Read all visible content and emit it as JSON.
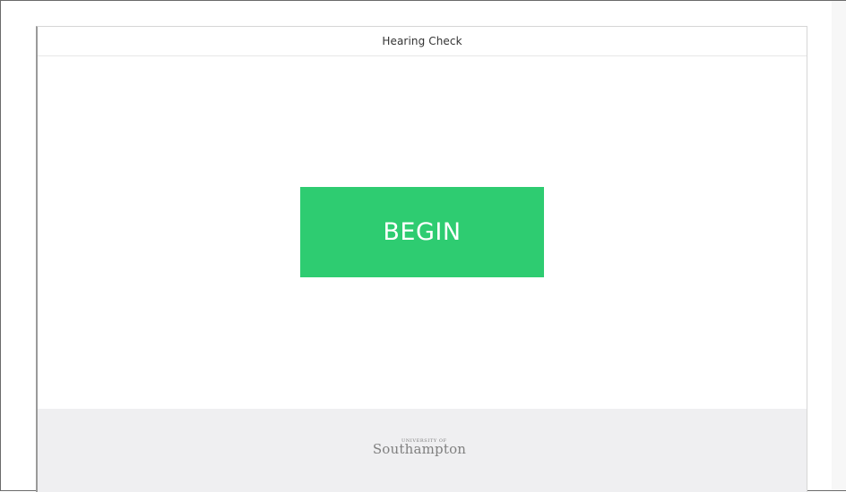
{
  "app": {
    "title": "Hearing Check",
    "begin_label": "BEGIN"
  },
  "footer": {
    "logo_top": "UNIVERSITY OF",
    "logo_main": "Southampton"
  },
  "colors": {
    "accent": "#2ecc71",
    "footer_bg": "#efeff1"
  },
  "icons": {
    "logo": "university-of-southampton-logo"
  }
}
